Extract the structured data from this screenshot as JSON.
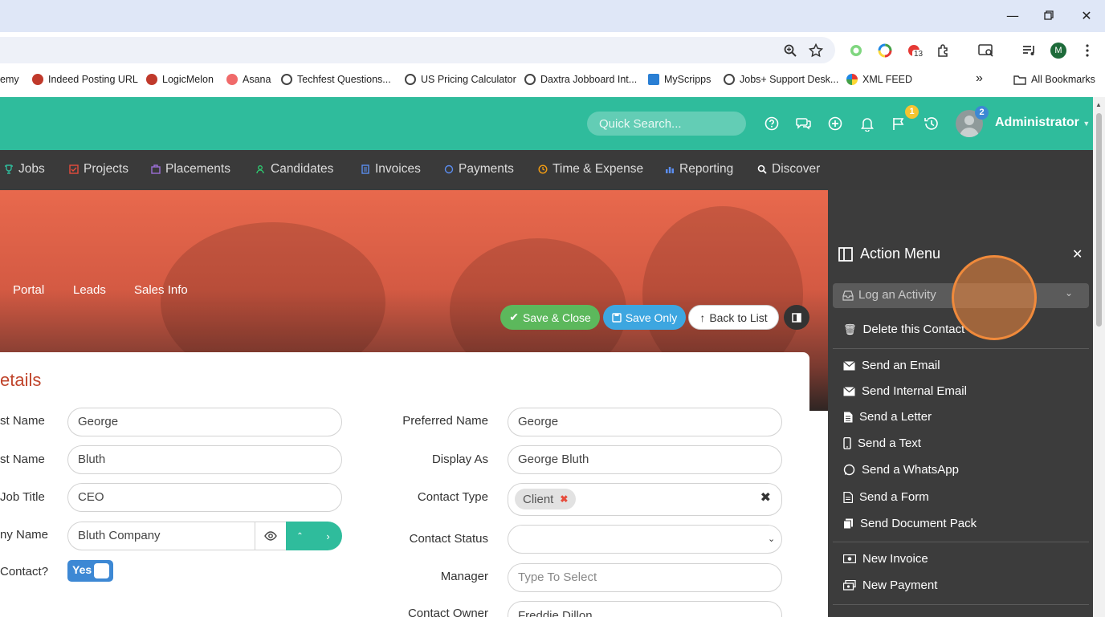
{
  "browser": {
    "profile_initial": "M",
    "extension_badge": "13",
    "bookmarks": [
      {
        "label": "emy"
      },
      {
        "label": "Indeed Posting URL"
      },
      {
        "label": "LogicMelon"
      },
      {
        "label": "Asana"
      },
      {
        "label": "Techfest Questions..."
      },
      {
        "label": "US Pricing Calculator"
      },
      {
        "label": "Daxtra Jobboard Int..."
      },
      {
        "label": "MyScripps"
      },
      {
        "label": "Jobs+ Support Desk..."
      },
      {
        "label": "XML FEED"
      }
    ],
    "overflow_glyph": "»",
    "all_bookmarks": "All Bookmarks"
  },
  "header": {
    "search_placeholder": "Quick Search...",
    "flag_badge": "1",
    "avatar_badge": "2",
    "user_name": "Administrator",
    "accent_color": "#2fbc9c"
  },
  "nav": {
    "items": [
      {
        "label": "Jobs",
        "color": "#2fbc9c"
      },
      {
        "label": "Projects",
        "color": "#e74c3c"
      },
      {
        "label": "Placements",
        "color": "#9b6fd6"
      },
      {
        "label": "Candidates",
        "color": "#2ecc71"
      },
      {
        "label": "Invoices",
        "color": "#5b8def"
      },
      {
        "label": "Payments",
        "color": "#5b8def"
      },
      {
        "label": "Time & Expense",
        "color": "#f39c12"
      },
      {
        "label": "Reporting",
        "color": "#5b8def"
      },
      {
        "label": "Discover",
        "color": "#ffffff"
      }
    ]
  },
  "banner": {
    "tabs": [
      "Portal",
      "Leads",
      "Sales Info"
    ],
    "save_close": "Save & Close",
    "save_only": "Save Only",
    "back_to_list": "Back to List"
  },
  "form": {
    "section_title": "etails",
    "left": [
      {
        "label": "st Name",
        "value": "George"
      },
      {
        "label": "st Name",
        "value": "Bluth"
      },
      {
        "label": "Job Title",
        "value": "CEO"
      },
      {
        "label": "ny Name",
        "value": "Bluth Company"
      },
      {
        "label": "Contact?",
        "value": "Yes"
      }
    ],
    "right": [
      {
        "label": "Preferred Name",
        "value": "George"
      },
      {
        "label": "Display As",
        "value": "George Bluth"
      },
      {
        "label": "Contact Type",
        "value": "Client"
      },
      {
        "label": "Contact Status",
        "value": ""
      },
      {
        "label": "Manager",
        "placeholder": "Type To Select"
      },
      {
        "label": "Contact Owner",
        "value": "Freddie Dillon"
      }
    ]
  },
  "action_menu": {
    "title": "Action Menu",
    "select_label": "Log an Activity",
    "items": [
      {
        "label": "Delete this Contact",
        "icon": "trash-icon"
      },
      {
        "label": "Send an Email",
        "icon": "envelope-icon"
      },
      {
        "label": "Send Internal Email",
        "icon": "envelope-icon"
      },
      {
        "label": "Send a Letter",
        "icon": "file-icon"
      },
      {
        "label": "Send a Text",
        "icon": "mobile-icon"
      },
      {
        "label": "Send a WhatsApp",
        "icon": "whatsapp-icon"
      },
      {
        "label": "Send a Form",
        "icon": "form-icon"
      },
      {
        "label": "Send Document Pack",
        "icon": "documents-icon"
      },
      {
        "label": "New Invoice",
        "icon": "money-icon"
      },
      {
        "label": "New Payment",
        "icon": "payment-icon"
      }
    ]
  }
}
